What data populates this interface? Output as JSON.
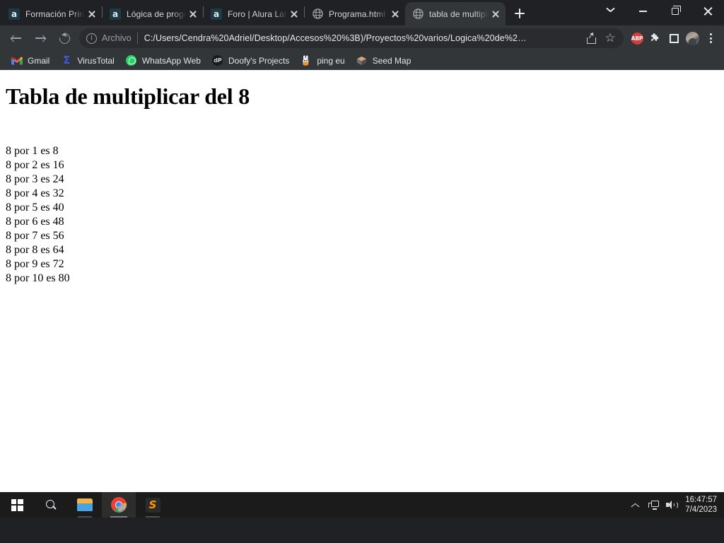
{
  "window": {
    "controls": {
      "chevron_label": "chevron-down",
      "minimize_label": "minimize",
      "maximize_label": "maximize",
      "close_label": "close"
    }
  },
  "tabs": [
    {
      "title": "Formación Princ",
      "favicon": "alura-a-icon",
      "active": false
    },
    {
      "title": "Lógica de progr",
      "favicon": "alura-a-icon",
      "active": false
    },
    {
      "title": "Foro | Alura Lat",
      "favicon": "alura-a-icon",
      "active": false
    },
    {
      "title": "Programa.html",
      "favicon": "globe-icon",
      "active": false
    },
    {
      "title": "tabla de multipli",
      "favicon": "globe-icon",
      "active": true
    }
  ],
  "new_tab_label": "+",
  "toolbar": {
    "back_label": "Atrás",
    "forward_label": "Adelante",
    "reload_label": "Recargar",
    "omnibox": {
      "scheme_label": "Archivo",
      "url": "C:/Users/Cendra%20Adriel/Desktop/Accesos%20%3B)/Proyectos%20varios/Logica%20de%2…",
      "share_label": "Compartir",
      "bookmark_label": "Marcador"
    },
    "extensions": [
      {
        "name": "adblock-plus-icon",
        "label": "ABP",
        "color": "#d93b3b"
      },
      {
        "name": "puzzle-icon",
        "label": "Extensiones"
      },
      {
        "name": "square-icon",
        "label": "Lector"
      }
    ],
    "profile_label": "Perfil",
    "menu_label": "Personaliza y controla Google Chrome"
  },
  "bookmarks": [
    {
      "label": "Gmail",
      "icon": "gmail-icon"
    },
    {
      "label": "VirusTotal",
      "icon": "virustotal-icon"
    },
    {
      "label": "WhatsApp Web",
      "icon": "whatsapp-icon"
    },
    {
      "label": "Doofy's Projects",
      "icon": "doofy-icon"
    },
    {
      "label": "ping eu",
      "icon": "ping-eu-icon"
    },
    {
      "label": "Seed Map",
      "icon": "seed-map-icon"
    }
  ],
  "page": {
    "heading": "Tabla de multiplicar del 8",
    "lines": [
      "8 por 1 es 8",
      "8 por 2 es 16",
      "8 por 3 es 24",
      "8 por 4 es 32",
      "8 por 5 es 40",
      "8 por 6 es 48",
      "8 por 7 es 56",
      "8 por 8 es 64",
      "8 por 9 es 72",
      "8 por 10 es 80"
    ]
  },
  "taskbar": {
    "items": [
      {
        "name": "start-button",
        "label": "Inicio",
        "state": "idle"
      },
      {
        "name": "search-button",
        "label": "Buscar",
        "state": "idle"
      },
      {
        "name": "file-explorer-button",
        "label": "Explorador de archivos",
        "state": "open"
      },
      {
        "name": "chrome-button",
        "label": "Google Chrome",
        "state": "active"
      },
      {
        "name": "sublime-text-button",
        "label": "Sublime Text",
        "state": "open"
      }
    ],
    "tray": {
      "overflow_label": "Mostrar iconos ocultos",
      "network_label": "Red",
      "volume_label": "Volumen",
      "time": "16:47:57",
      "date": "7/4/2023"
    }
  }
}
